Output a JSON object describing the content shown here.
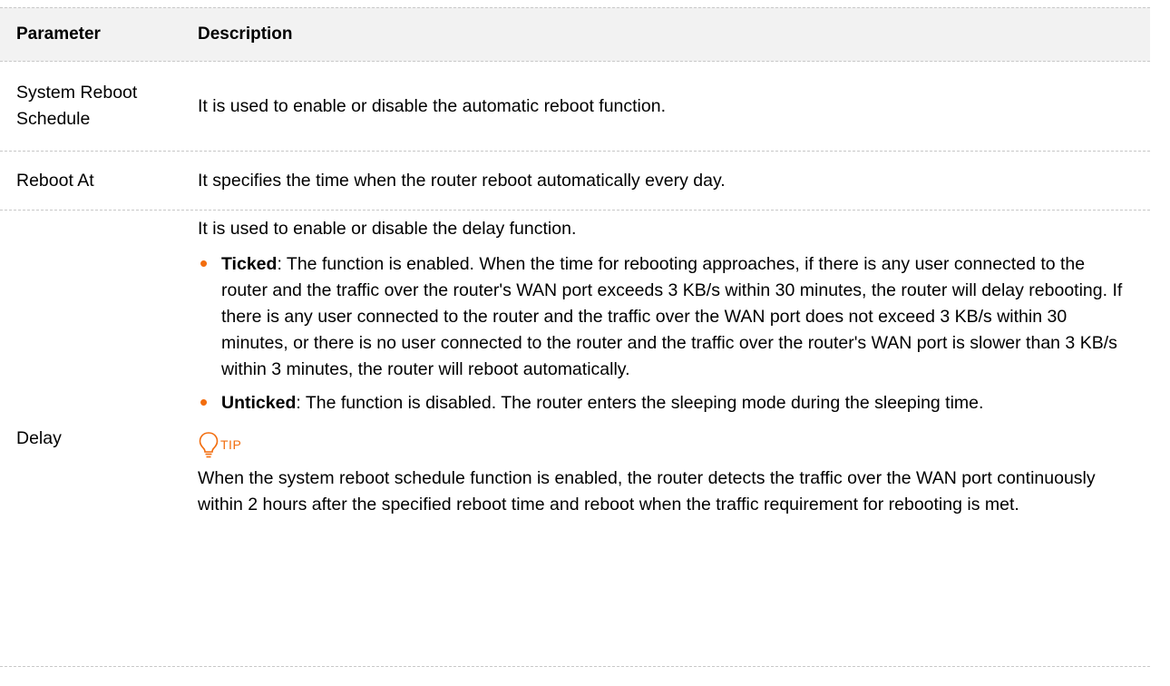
{
  "table": {
    "headers": {
      "parameter": "Parameter",
      "description": "Description"
    },
    "rows": [
      {
        "parameter": "System Reboot Schedule",
        "description": "It is used to enable or disable the automatic reboot function."
      },
      {
        "parameter": "Reboot At",
        "description": "It specifies the time when the router reboot automatically every day."
      },
      {
        "parameter": "Delay",
        "intro": "It is used to enable or disable the delay function.",
        "bullets": [
          {
            "term": "Ticked",
            "text": ": The function is enabled. When the time for rebooting approaches, if there is any user connected to the router and the traffic over the router's WAN port exceeds 3 KB/s within 30 minutes, the router will delay rebooting. If there is any user connected to the router and the traffic over the WAN port does not exceed 3 KB/s within 30 minutes, or there is no user connected to the router and the traffic over the router's WAN port is slower than 3 KB/s within 3 minutes, the router will reboot automatically."
          },
          {
            "term": "Unticked",
            "text": ": The function is disabled. The router enters the sleeping mode during the sleeping time."
          }
        ],
        "tip": {
          "label": "TIP",
          "icon": "lightbulb-icon",
          "text": "When the system reboot schedule function is enabled, the router detects the traffic over the WAN port continuously within 2 hours after the specified reboot time and reboot when the traffic requirement for rebooting is met."
        }
      }
    ]
  },
  "colors": {
    "accent": "#f26d0e",
    "header_bg": "#f2f2f2",
    "divider": "#c8c8c8"
  }
}
